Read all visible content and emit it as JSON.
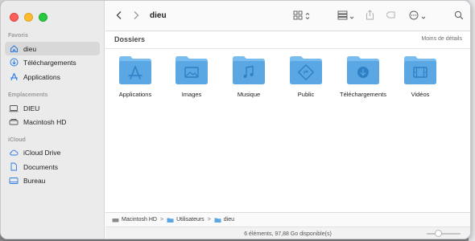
{
  "window": {
    "title": "dieu"
  },
  "sidebar": {
    "sections": [
      {
        "title": "Favoris",
        "items": [
          {
            "label": "dieu",
            "icon": "home-icon",
            "active": true
          },
          {
            "label": "Téléchargements",
            "icon": "download-icon"
          },
          {
            "label": "Applications",
            "icon": "applications-icon"
          }
        ]
      },
      {
        "title": "Emplacements",
        "items": [
          {
            "label": "DIEU",
            "icon": "computer-icon"
          },
          {
            "label": "Macintosh HD",
            "icon": "disk-icon"
          }
        ]
      },
      {
        "title": "iCloud",
        "items": [
          {
            "label": "iCloud Drive",
            "icon": "cloud-icon"
          },
          {
            "label": "Documents",
            "icon": "document-icon"
          },
          {
            "label": "Bureau",
            "icon": "desktop-icon"
          }
        ]
      }
    ]
  },
  "content": {
    "section_title": "Dossiers",
    "section_link": "Moins de détails",
    "folders": [
      {
        "label": "Applications",
        "icon": "applications-folder-icon"
      },
      {
        "label": "Images",
        "icon": "images-folder-icon"
      },
      {
        "label": "Musique",
        "icon": "music-folder-icon"
      },
      {
        "label": "Public",
        "icon": "public-folder-icon"
      },
      {
        "label": "Téléchargements",
        "icon": "downloads-folder-icon"
      },
      {
        "label": "Vidéos",
        "icon": "videos-folder-icon"
      }
    ]
  },
  "pathbar": {
    "crumbs": [
      "Macintosh HD",
      "Utilisateurs",
      "dieu"
    ],
    "separator": ">"
  },
  "status": {
    "text": "6 éléments, 97,88 Go disponible(s)"
  },
  "zoom_slider": {
    "value": 0.3
  },
  "colors": {
    "folder": "#5aa7e3",
    "folder_tab": "#79bdf0",
    "accent": "#2c7be5"
  }
}
